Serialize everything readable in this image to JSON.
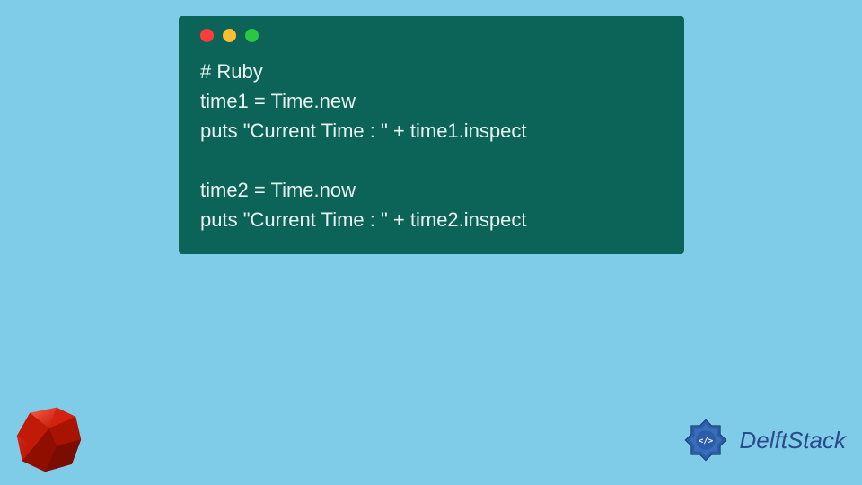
{
  "code": {
    "lines": [
      "# Ruby",
      "time1 = Time.new",
      "puts \"Current Time : \" + time1.inspect",
      "",
      "time2 = Time.now",
      "puts \"Current Time : \" + time2.inspect"
    ]
  },
  "brand": {
    "name": "DelftStack"
  },
  "colors": {
    "background": "#7fcce9",
    "windowBg": "#0c6358",
    "dotRed": "#fc3d39",
    "dotYellow": "#febf2d",
    "dotGreen": "#2ac740",
    "codeText": "#e8f4f2",
    "brandText": "#2a4a8a",
    "rubyRed": "#a91401"
  }
}
